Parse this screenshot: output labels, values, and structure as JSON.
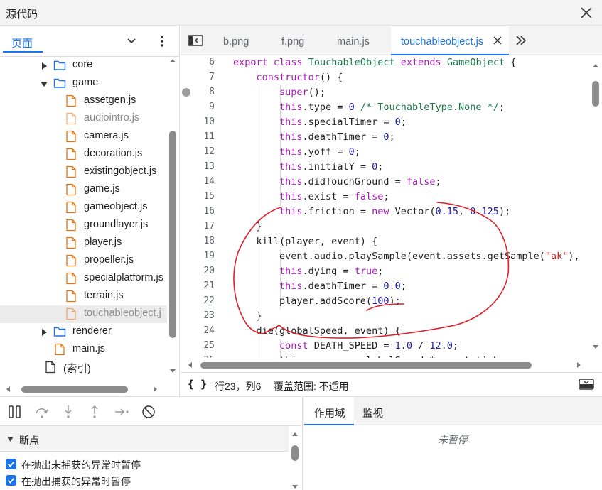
{
  "window": {
    "title": "源代码"
  },
  "navigator": {
    "tab_label": "页面",
    "tree": [
      {
        "label": "core",
        "type": "folder",
        "expanded": false,
        "depth": 2
      },
      {
        "label": "game",
        "type": "folder",
        "expanded": true,
        "depth": 2
      },
      {
        "label": "assetgen.js",
        "type": "file",
        "depth": 3
      },
      {
        "label": "audiointro.js",
        "type": "file",
        "depth": 3,
        "dim": true
      },
      {
        "label": "camera.js",
        "type": "file",
        "depth": 3
      },
      {
        "label": "decoration.js",
        "type": "file",
        "depth": 3
      },
      {
        "label": "existingobject.js",
        "type": "file",
        "depth": 3
      },
      {
        "label": "game.js",
        "type": "file",
        "depth": 3
      },
      {
        "label": "gameobject.js",
        "type": "file",
        "depth": 3
      },
      {
        "label": "groundlayer.js",
        "type": "file",
        "depth": 3
      },
      {
        "label": "player.js",
        "type": "file",
        "depth": 3
      },
      {
        "label": "propeller.js",
        "type": "file",
        "depth": 3
      },
      {
        "label": "specialplatform.js",
        "type": "file",
        "depth": 3
      },
      {
        "label": "terrain.js",
        "type": "file",
        "depth": 3
      },
      {
        "label": "touchableobject.j",
        "type": "file",
        "depth": 3,
        "dim": true,
        "selected": true
      },
      {
        "label": "renderer",
        "type": "folder",
        "expanded": false,
        "depth": 2
      },
      {
        "label": "main.js",
        "type": "file",
        "depth": 2
      },
      {
        "label": "(索引)",
        "type": "doc",
        "depth": 1
      }
    ]
  },
  "editor": {
    "tabs": [
      {
        "label": "b.png",
        "active": false
      },
      {
        "label": "f.png",
        "active": false
      },
      {
        "label": "main.js",
        "active": false
      },
      {
        "label": "touchableobject.js",
        "active": true
      }
    ],
    "lines": [
      {
        "n": "6",
        "text": "export class TouchableObject extends GameObject {"
      },
      {
        "n": "7",
        "text": "    constructor() {"
      },
      {
        "n": "8",
        "text": "        super();",
        "breakpoint": true
      },
      {
        "n": "9",
        "text": "        this.type = 0 /* TouchableType.None */;"
      },
      {
        "n": "10",
        "text": "        this.specialTimer = 0;"
      },
      {
        "n": "11",
        "text": "        this.deathTimer = 0;"
      },
      {
        "n": "12",
        "text": "        this.yoff = 0;"
      },
      {
        "n": "13",
        "text": "        this.initialY = 0;"
      },
      {
        "n": "14",
        "text": "        this.didTouchGround = false;"
      },
      {
        "n": "15",
        "text": "        this.exist = false;"
      },
      {
        "n": "16",
        "text": "        this.friction = new Vector(0.15, 0.125);"
      },
      {
        "n": "17",
        "text": "    }"
      },
      {
        "n": "18",
        "text": "    kill(player, event) {"
      },
      {
        "n": "19",
        "text": "        event.audio.playSample(event.assets.getSample(\"ak\"),"
      },
      {
        "n": "20",
        "text": "        this.dying = true;"
      },
      {
        "n": "21",
        "text": "        this.deathTimer = 0.0;"
      },
      {
        "n": "22",
        "text": "        player.addScore(100);"
      },
      {
        "n": "23",
        "text": "    }"
      },
      {
        "n": "24",
        "text": "    die(globalSpeed, event) {"
      },
      {
        "n": "25",
        "text": "        const DEATH_SPEED = 1.0 / 12.0;"
      },
      {
        "n": "26",
        "text": "        this.pos.y -= globalSpeed * event.tick;"
      }
    ]
  },
  "status": {
    "braces": "{ }",
    "position": "行23，列6",
    "coverage": "覆盖范围: 不适用"
  },
  "breakpoints": {
    "section_label": "断点",
    "options": [
      {
        "label": "在抛出未捕获的异常时暂停",
        "checked": true
      },
      {
        "label": "在抛出捕获的异常时暂停",
        "checked": true
      }
    ]
  },
  "scope": {
    "tabs": [
      {
        "label": "作用域",
        "active": true
      },
      {
        "label": "监视",
        "active": false
      }
    ],
    "message": "未暂停"
  },
  "colors": {
    "accent": "#1a73e8",
    "keyword": "#a51cb6",
    "class_name": "#1b7a4c",
    "number": "#1a1aa6",
    "string": "#c41a16",
    "annotation_ink": "#e0202a",
    "folder_icon": "#1a73e8",
    "file_icon": "#e8710a"
  },
  "icons": {
    "close": "close-icon",
    "chevron": "chevron-down-icon",
    "more": "more-vertical-icon",
    "toggle_nav": "toggle-navigator-icon",
    "more_tabs": "double-chevron-icon",
    "pause": "pause-icon",
    "step_over": "step-over-icon",
    "step_into": "step-into-icon",
    "step_out": "step-out-icon",
    "step": "step-icon",
    "deactivate_breakpoints": "deactivate-breakpoints-icon",
    "dock": "dock-icon"
  }
}
